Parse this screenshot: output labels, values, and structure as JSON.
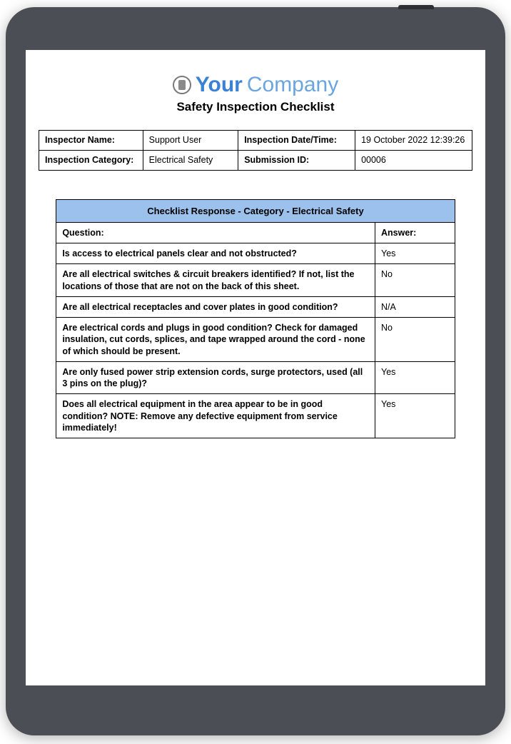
{
  "logo": {
    "strong": "Your",
    "light": " Company"
  },
  "subtitle": "Safety Inspection Checklist",
  "info": {
    "inspector_label": "Inspector Name:",
    "inspector_value": "Support User",
    "datetime_label": "Inspection Date/Time:",
    "datetime_value": "19 October 2022 12:39:26",
    "category_label": "Inspection Category:",
    "category_value": "Electrical Safety",
    "submission_label": "Submission ID:",
    "submission_value": "00006"
  },
  "checklist": {
    "section_header": "Checklist Response - Category - Electrical Safety",
    "question_header": "Question:",
    "answer_header": "Answer:",
    "rows": [
      {
        "q": "Is access to electrical panels clear and not obstructed?",
        "a": "Yes"
      },
      {
        "q": "Are all electrical switches & circuit breakers identified? If not, list the locations of those that are not on the back of this sheet.",
        "a": "No"
      },
      {
        "q": "Are all electrical receptacles and cover plates in good condition?",
        "a": "N/A"
      },
      {
        "q": "Are electrical cords and plugs in good condition? Check for damaged insulation, cut cords, splices, and tape wrapped around the cord - none of which should be present.",
        "a": "No"
      },
      {
        "q": "Are only fused power strip extension cords, surge protectors, used (all 3 pins on the plug)?",
        "a": "Yes"
      },
      {
        "q": "Does all electrical equipment in the area appear to be in good condition? NOTE: Remove any defective equipment from service immediately!",
        "a": "Yes"
      }
    ]
  }
}
